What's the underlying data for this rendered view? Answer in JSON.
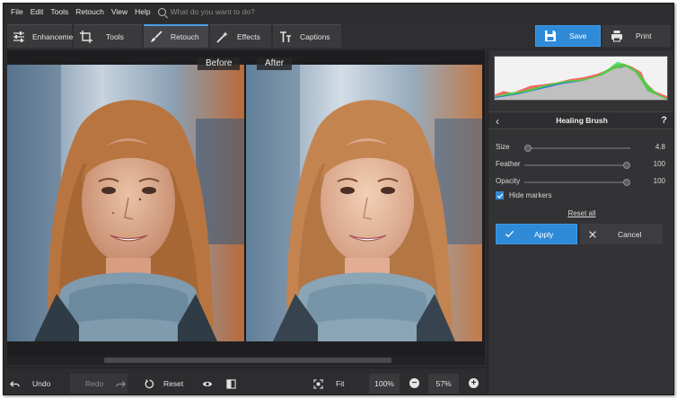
{
  "menu": [
    "File",
    "Edit",
    "Tools",
    "Retouch",
    "View",
    "Help"
  ],
  "search": {
    "placeholder": "What do you want to do?"
  },
  "tabs": [
    {
      "label": "Enhancement",
      "icon": "sliders-icon"
    },
    {
      "label": "Tools",
      "icon": "crop-icon"
    },
    {
      "label": "Retouch",
      "icon": "brush-icon",
      "active": true
    },
    {
      "label": "Effects",
      "icon": "magic-wand-icon"
    },
    {
      "label": "Captions",
      "icon": "text-icon"
    }
  ],
  "toolbar": {
    "save_label": "Save",
    "print_label": "Print"
  },
  "canvas": {
    "before_label": "Before",
    "after_label": "After"
  },
  "panel": {
    "title": "Healing Brush",
    "help": "?",
    "back": "‹",
    "sliders": [
      {
        "label": "Size",
        "value": "4.8",
        "fraction": 0.0
      },
      {
        "label": "Feather",
        "value": "100",
        "fraction": 1.0
      },
      {
        "label": "Opacity",
        "value": "100",
        "fraction": 1.0
      }
    ],
    "hide_markers": {
      "label": "Hide markers",
      "checked": true
    },
    "reset_all": "Reset all",
    "apply_label": "Apply",
    "cancel_label": "Cancel"
  },
  "bottom": {
    "undo_label": "Undo",
    "redo_label": "Redo",
    "reset_label": "Reset",
    "fit_label": "Fit",
    "zoom_100": "100%",
    "zoom_value": "57%",
    "zoom_out": "−",
    "zoom_in": "+"
  },
  "colors": {
    "accent": "#2f8ad8",
    "background": "#2b2b2d",
    "panel": "#333336"
  }
}
